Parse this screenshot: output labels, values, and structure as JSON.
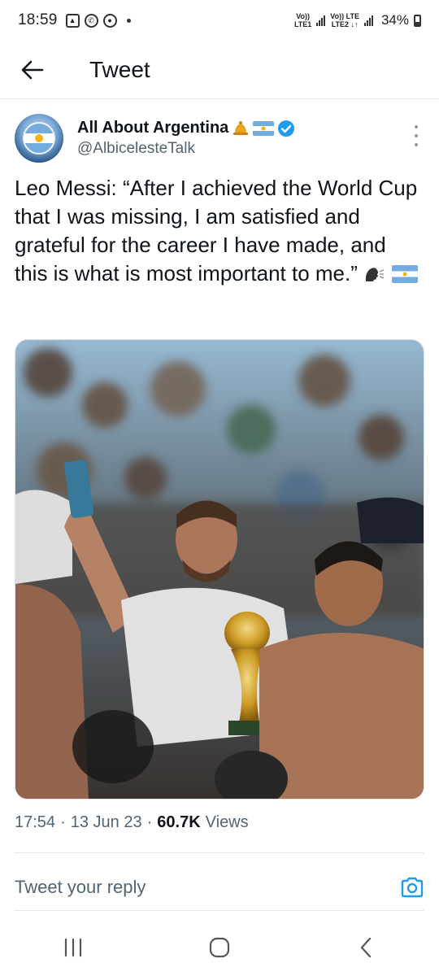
{
  "status_bar": {
    "time": "18:59",
    "left_icons": [
      "gallery-icon",
      "whatsapp-icon",
      "chrome-icon",
      "dot-icon"
    ],
    "sim1_label_top": "Vo))",
    "sim1_label_bottom": "LTE1",
    "sim2_label_top": "Vo)) LTE",
    "sim2_label_bottom": "LTE2 ↓↑",
    "battery": "34%"
  },
  "header": {
    "title": "Tweet"
  },
  "tweet": {
    "author_name": "All About Argentina",
    "author_handle": "@AlbicelesteTalk",
    "text": "Leo Messi: “After I achieved the World Cup that I was missing, I am satisfied and grateful for the career I have made, and this is what is most important to me.”",
    "image_alt": "Messi taking a selfie while holding the World Cup trophy among fans",
    "time": "17:54",
    "date": "13 Jun 23",
    "views_count": "60.7K",
    "views_label": "Views",
    "separator": "·"
  },
  "reply": {
    "placeholder": "Tweet your reply"
  },
  "colors": {
    "twitter_blue": "#1d9bf0",
    "text_primary": "#0f1419",
    "text_secondary": "#536471",
    "argentina_blue": "#74acdf",
    "argentina_sun": "#f6b40e"
  },
  "nav_bar": {
    "icons": [
      "recent-apps-icon",
      "home-icon",
      "back-icon"
    ]
  }
}
